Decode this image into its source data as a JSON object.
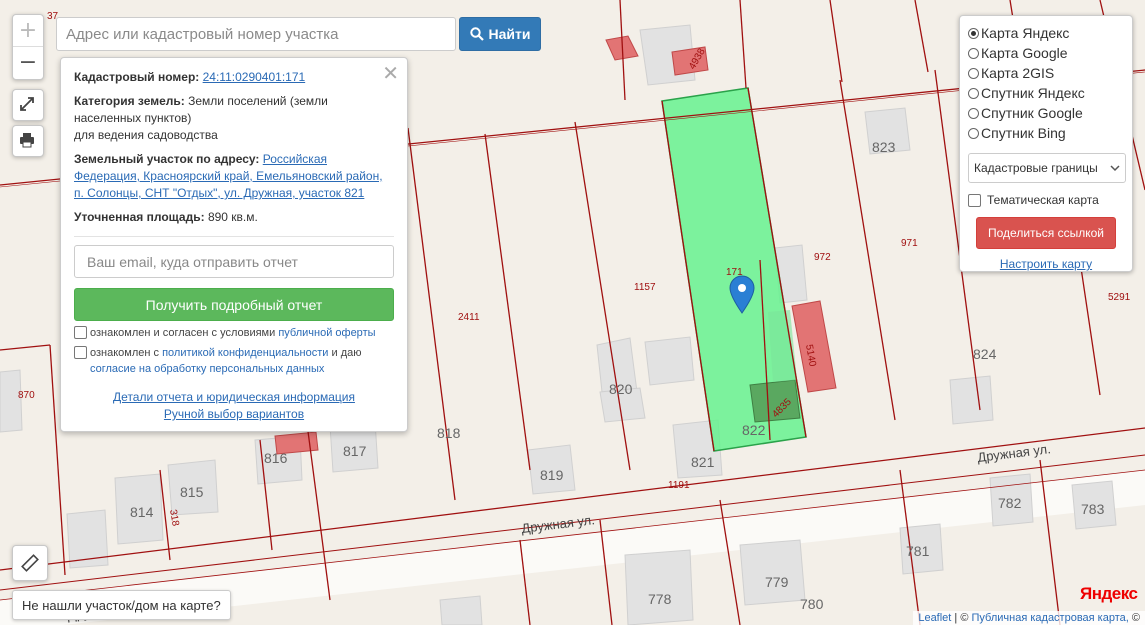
{
  "search": {
    "placeholder": "Адрес или кадастровый номер участка",
    "button_label": "Найти"
  },
  "zoom": {
    "in": "+",
    "out": "−"
  },
  "popup": {
    "close": "✕",
    "cadastral_label": "Кадастровый номер:",
    "cadastral_value": "24:11:0290401:171",
    "category_label": "Категория земель:",
    "category_value": "Земли поселений (земли населенных пунктов)",
    "category_use": "для ведения садоводства",
    "address_label": "Земельный участок по адресу:",
    "address_value": "Российская Федерация, Красноярский край, Емельяновский район, п. Солонцы, СНТ \"Отдых\", ул. Дружная, участок 821",
    "area_label": "Уточненная площадь:",
    "area_value": "890 кв.м.",
    "email_placeholder": "Ваш email, куда отправить отчет",
    "get_report": "Получить подробный отчет",
    "agree1_text": "ознакомлен и согласен с условиями",
    "agree1_link": "публичной оферты",
    "agree2_text": "ознакомлен с",
    "agree2_link": "политикой конфиденциальности",
    "agree2_tail": "и даю",
    "agree2_link2": "согласие на обработку персональных данных",
    "details_link": "Детали отчета и юридическая информация",
    "manual_link": "Ручной выбор вариантов"
  },
  "layers": {
    "options": [
      "Карта Яндекс",
      "Карта Google",
      "Карта 2GIS",
      "Спутник Яндекс",
      "Спутник Google",
      "Спутник Bing"
    ],
    "selected_index": 0,
    "select_value": "Кадастровые границы",
    "thematic": "Тематическая карта",
    "share": "Поделиться ссылкой",
    "setup": "Настроить карту"
  },
  "not_found": "Не нашли участок/дом на карте?",
  "attribution": {
    "leaflet": "Leaflet",
    "sep": "| ©",
    "pkk": "Публичная кадастровая карта,",
    "tail": "©"
  },
  "yandex_logo": "Яндекс",
  "map_labels": {
    "street1": "Дружная ул.",
    "street2": "Дружная ул.",
    "street3": "Дру",
    "red_numbers": [
      "37",
      "870",
      "2411",
      "1157",
      "171",
      "972",
      "971",
      "5291",
      "1191",
      "318",
      "4938",
      "5140",
      "4835"
    ],
    "house_numbers": [
      "823",
      "824",
      "820",
      "818",
      "817",
      "816",
      "815",
      "814",
      "819",
      "821",
      "822",
      "782",
      "783",
      "781",
      "779",
      "778",
      "780"
    ]
  },
  "colors": {
    "parcel_fill": "#66f28f",
    "parcel_line": "#a01010",
    "search_btn": "#337ab7",
    "get_btn": "#5cb85c",
    "share_btn": "#d9534f",
    "marker": "#2a7fd4"
  }
}
